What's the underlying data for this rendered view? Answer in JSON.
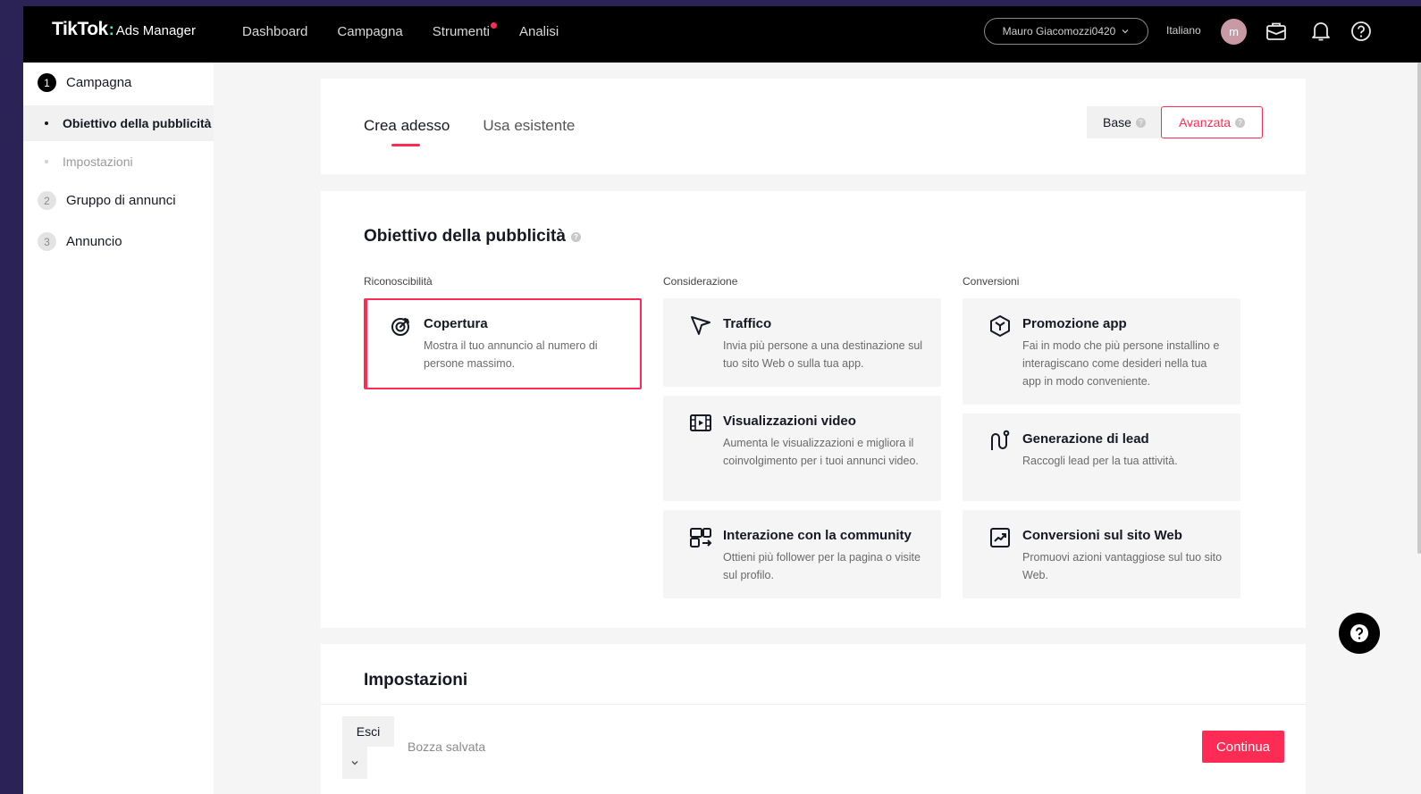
{
  "brand": {
    "logo": "TikTok",
    "product": "Ads Manager"
  },
  "nav": {
    "links": [
      "Dashboard",
      "Campagna",
      "Strumenti",
      "Analisi"
    ],
    "account": "Mauro Giacomozzi0420",
    "language": "Italiano",
    "avatar_initial": "m"
  },
  "sidebar": {
    "steps": [
      {
        "num": "1",
        "label": "Campagna"
      },
      {
        "num": "2",
        "label": "Gruppo di annunci"
      },
      {
        "num": "3",
        "label": "Annuncio"
      }
    ],
    "substeps": [
      "Obiettivo della pubblicità",
      "Impostazioni"
    ]
  },
  "tabs": {
    "active": "Crea adesso",
    "other": "Usa esistente"
  },
  "mode": {
    "base": "Base",
    "advanced": "Avanzata"
  },
  "objective": {
    "title": "Obiettivo della pubblicità",
    "columns": [
      "Riconoscibilità",
      "Considerazione",
      "Conversioni"
    ],
    "options": [
      {
        "title": "Copertura",
        "desc": "Mostra il tuo annuncio al numero di persone massimo.",
        "icon": "target-icon"
      },
      {
        "title": "Traffico",
        "desc": "Invia più persone a una destinazione sul tuo sito Web o sulla tua app.",
        "icon": "cursor-icon"
      },
      {
        "title": "Visualizzazioni video",
        "desc": "Aumenta le visualizzazioni e migliora il coinvolgimento per i tuoi annunci video.",
        "icon": "film-icon"
      },
      {
        "title": "Interazione con la community",
        "desc": "Ottieni più follower per la pagina o visite sul profilo.",
        "icon": "community-icon"
      },
      {
        "title": "Promozione app",
        "desc": "Fai in modo che più persone installino e interagiscano come desideri nella tua app in modo conveniente.",
        "icon": "cube-icon"
      },
      {
        "title": "Generazione di lead",
        "desc": "Raccogli lead per la tua attività.",
        "icon": "magnet-icon"
      },
      {
        "title": "Conversioni sul sito Web",
        "desc": "Promuovi azioni vantaggiose sul tuo sito Web.",
        "icon": "trend-icon"
      }
    ]
  },
  "settings": {
    "title": "Impostazioni"
  },
  "footer": {
    "exit": "Esci",
    "draft": "Bozza salvata",
    "continue": "Continua"
  },
  "colors": {
    "accent": "#fe2c55",
    "nav_bg": "#000000",
    "backdrop": "#2b2356"
  }
}
